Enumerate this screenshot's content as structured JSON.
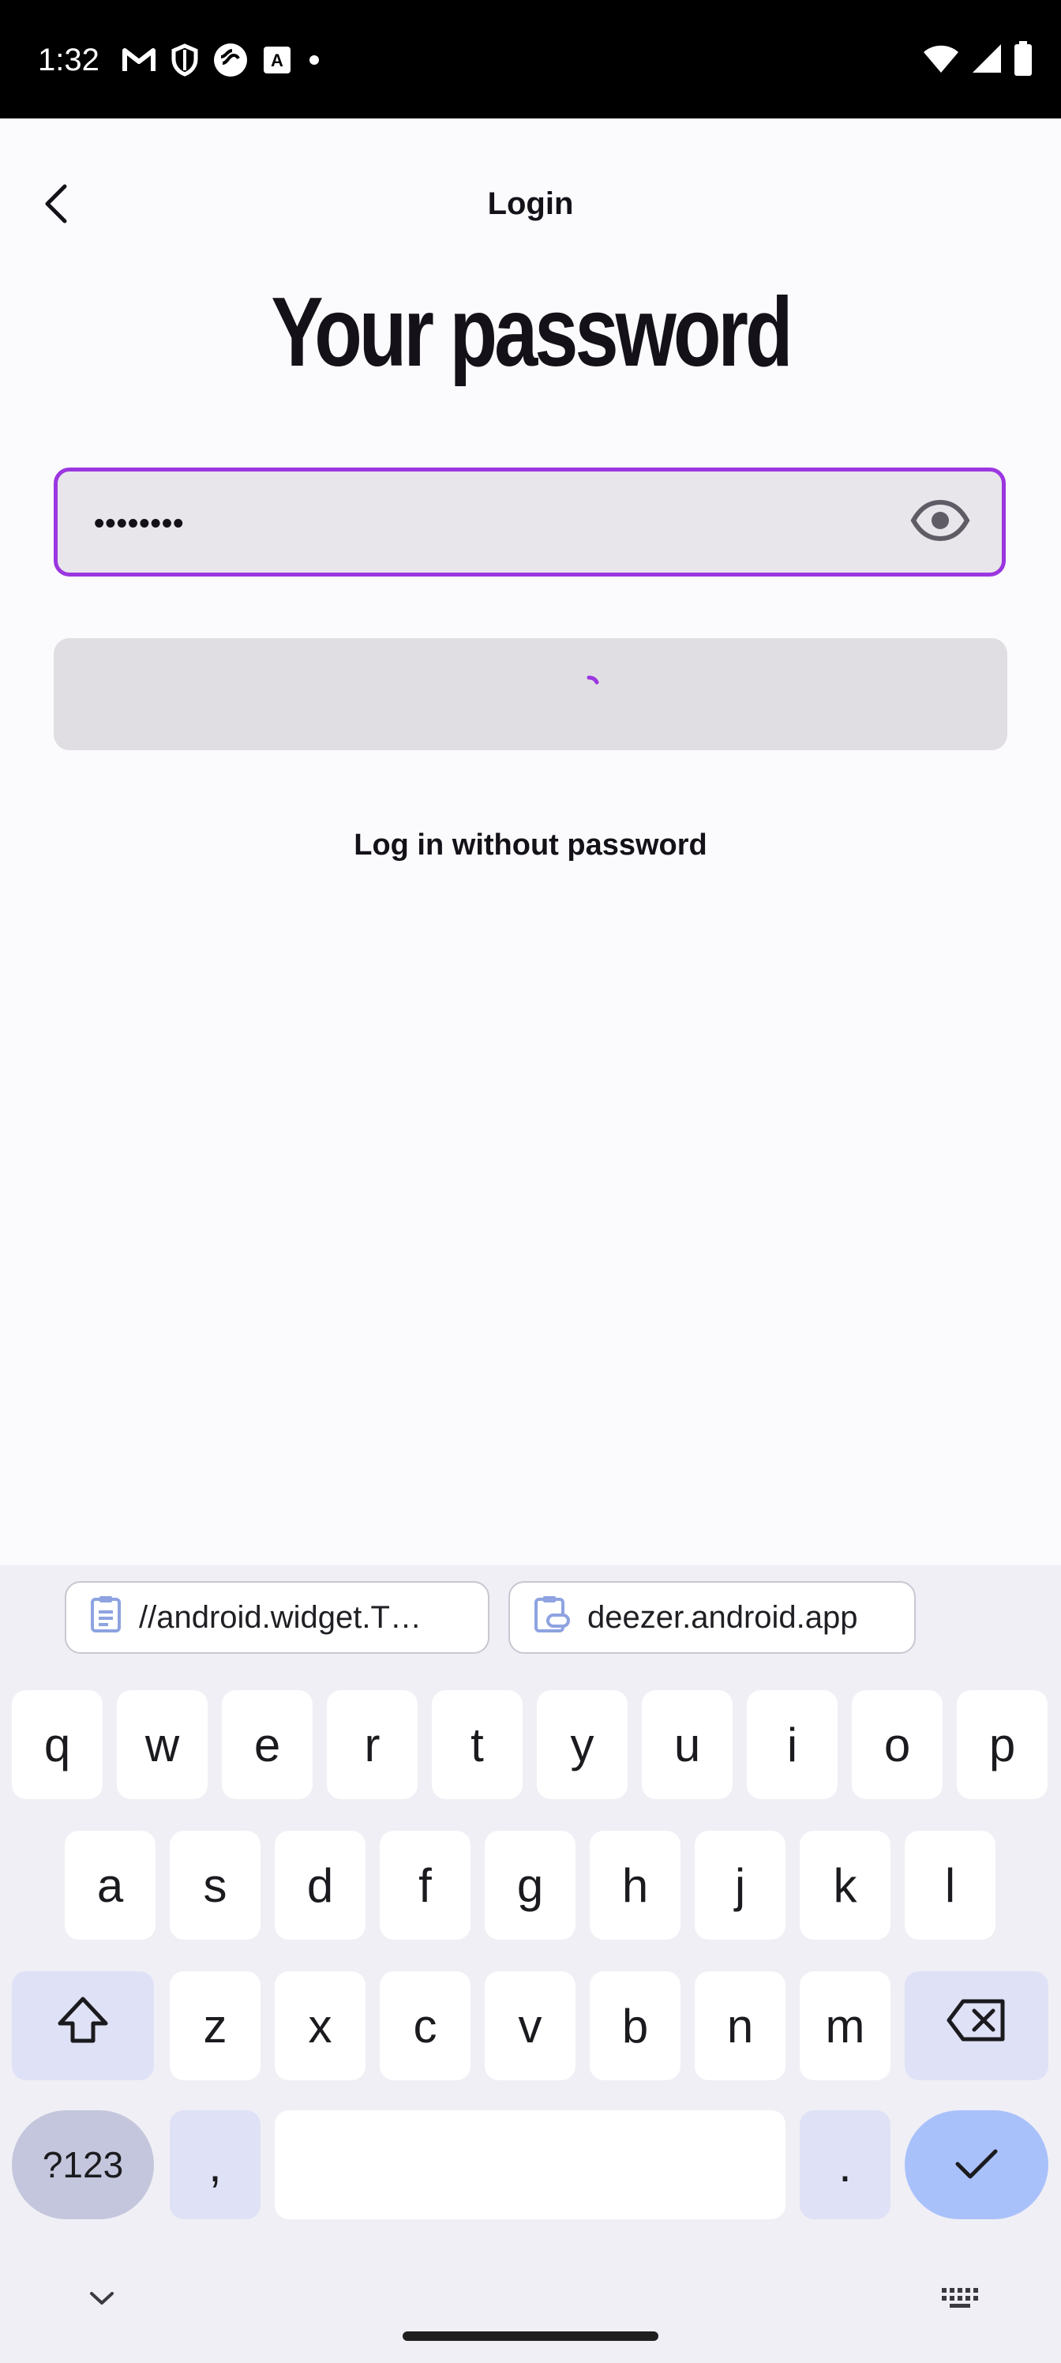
{
  "status_bar": {
    "time": "1:32",
    "left_icons": [
      "gmail-icon",
      "shield-icon",
      "deezer-icon",
      "translate-icon",
      "dot-icon"
    ],
    "right_icons": [
      "wifi-icon",
      "signal-icon",
      "battery-icon"
    ]
  },
  "app_bar": {
    "title": "Login",
    "back_icon": "chevron-left-icon"
  },
  "headline": "Your password",
  "password_field": {
    "value": "••••••••",
    "toggle_icon": "eye-icon",
    "border_color": "#9b36e0"
  },
  "submit_button": {
    "state": "loading",
    "spinner_color": "#9b36e0"
  },
  "no_password_link": "Log in without password",
  "keyboard": {
    "clipboard": [
      {
        "text": "//android.widget.T…",
        "icon": "clipboard-icon"
      },
      {
        "text": "deezer.android.app",
        "icon": "clipboard-link-icon"
      }
    ],
    "row1": [
      "q",
      "w",
      "e",
      "r",
      "t",
      "y",
      "u",
      "i",
      "o",
      "p"
    ],
    "row2": [
      "a",
      "s",
      "d",
      "f",
      "g",
      "h",
      "j",
      "k",
      "l"
    ],
    "row3": [
      "z",
      "x",
      "c",
      "v",
      "b",
      "n",
      "m"
    ],
    "symbols_label": "?123",
    "comma": ",",
    "period": ".",
    "shift_icon": "shift-icon",
    "backspace_icon": "backspace-icon",
    "enter_icon": "check-icon",
    "hide_icon": "chevron-down-icon",
    "switch_icon": "keyboard-icon"
  }
}
